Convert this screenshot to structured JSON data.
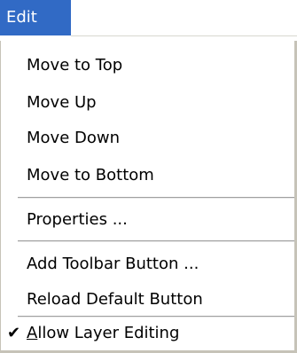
{
  "menubar": {
    "active_menu": "Edit"
  },
  "menu": {
    "items": [
      {
        "label": "Move to Top"
      },
      {
        "label": "Move Up"
      },
      {
        "label": "Move Down"
      },
      {
        "label": "Move to Bottom"
      },
      {
        "label": "Properties ..."
      },
      {
        "label": "Add Toolbar Button ..."
      },
      {
        "label": "Reload Default Button"
      },
      {
        "label_underlined_char": "A",
        "label_rest": "llow Layer Editing",
        "checked": true,
        "check_glyph": "✔"
      }
    ]
  },
  "colors": {
    "highlight": "#316ac5",
    "menu_border": "#c6c3b8",
    "separator": "#a0a0a0"
  }
}
